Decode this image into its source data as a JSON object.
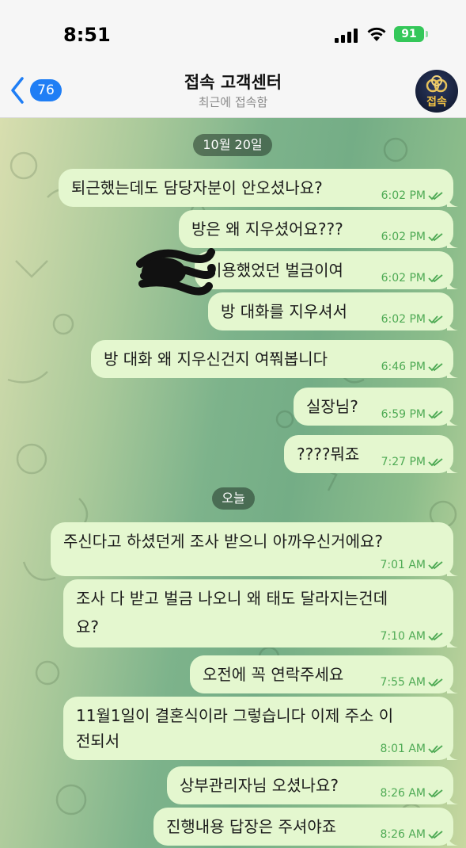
{
  "status_bar": {
    "time": "8:51",
    "battery": "91"
  },
  "header": {
    "back_count": "76",
    "title": "접속 고객센터",
    "subtitle": "최근에 접속함",
    "avatar_label": "접속"
  },
  "dates": {
    "first": "10월 20일",
    "second": "오늘"
  },
  "messages": [
    {
      "text": "퇴근했는데도 담당자분이 안오셨나요?",
      "time": "6:02 PM"
    },
    {
      "text": "방은 왜 지우셨어요???",
      "time": "6:02 PM"
    },
    {
      "text": "이용했었던 벌금이여",
      "time": "6:02 PM"
    },
    {
      "text": "방 대화를 지우셔서",
      "time": "6:02 PM"
    },
    {
      "text": "방 대화 왜 지우신건지 여쭤봅니다",
      "time": "6:46 PM"
    },
    {
      "text": "실장님?",
      "time": "6:59 PM"
    },
    {
      "text": "????뭐죠",
      "time": "7:27 PM"
    },
    {
      "text": "주신다고 하셨던게 조사 받으니 아까우신거에요?",
      "time": "7:01 AM"
    },
    {
      "line1": "조사 다 받고 벌금 나오니 왜 태도 달라지는건데",
      "line2": "요?",
      "time": "7:10 AM"
    },
    {
      "text": "오전에 꼭 연락주세요",
      "time": "7:55 AM"
    },
    {
      "line1": "11월1일이 결혼식이라 그렇습니다 이제 주소 이",
      "line2": "전되서",
      "time": "8:01 AM"
    },
    {
      "text": "상부관리자님 오셨나요?",
      "time": "8:26 AM"
    },
    {
      "text": "진행내용 답장은 주셔야죠",
      "time": "8:26 AM"
    }
  ],
  "colors": {
    "bubble": "#e4f7cf",
    "meta": "#4eaa54",
    "accent": "#1f7ef5"
  }
}
